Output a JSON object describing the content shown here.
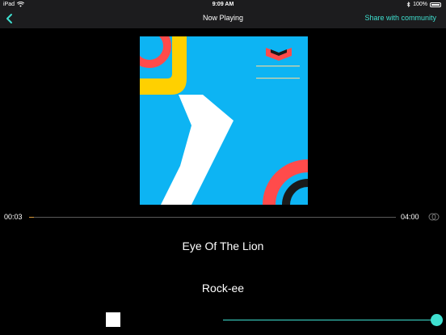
{
  "status_bar": {
    "carrier": "iPad",
    "time": "9:09 AM",
    "battery": "100%"
  },
  "nav": {
    "title": "Now Playing",
    "share_label": "Share with community"
  },
  "player": {
    "elapsed": "00:03",
    "total": "04:00",
    "progress_fraction": 0.0125,
    "song_title": "Eye Of The Lion",
    "artist": "Rock-ee",
    "volume_fraction": 1.0
  },
  "colors": {
    "accent": "#3fe0d0",
    "progress": "#d99a3a",
    "artwork_blue": "#0db4f3",
    "artwork_yellow": "#ffd000",
    "artwork_red": "#ff4b4b"
  },
  "icons": {
    "back": "chevron-left-icon",
    "wifi": "wifi-icon",
    "bluetooth": "bluetooth-icon",
    "battery": "battery-icon",
    "airplay": "airplay-icon"
  }
}
